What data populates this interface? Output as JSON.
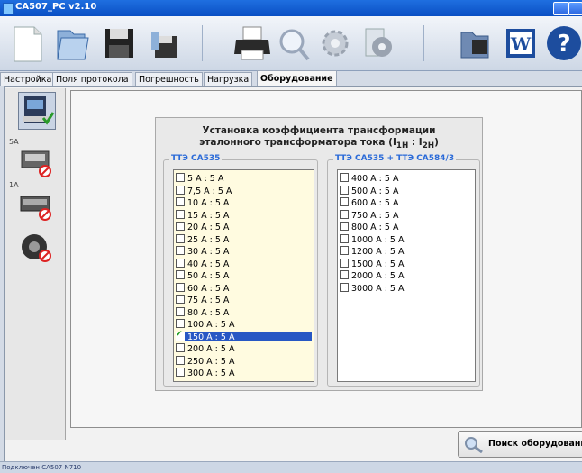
{
  "window": {
    "title": "CA507_PC v2.10"
  },
  "tabs": [
    {
      "label": "Настройка"
    },
    {
      "label": "Поля протокола"
    },
    {
      "label": "Погрешность"
    },
    {
      "label": "Нагрузка"
    },
    {
      "label": "Оборудование",
      "active": true
    }
  ],
  "sidebar": {
    "items": [
      {
        "label": ""
      },
      {
        "label": "5A"
      },
      {
        "label": "1A"
      },
      {
        "label": ""
      }
    ]
  },
  "dialog": {
    "title_line1": "Установка коэффициента трансформации",
    "title_line2": "эталонного трансформатора тока (I",
    "sub_1h": "1Н",
    "colon": " : I",
    "sub_2h": "2Н",
    "close_paren": ")",
    "group_left": {
      "label": "ТТЭ СА535",
      "items": [
        "5 A : 5 A",
        "7,5 A : 5 A",
        "10 A : 5 A",
        "15 A : 5 A",
        "20 A : 5 A",
        "25 A : 5 A",
        "30 A : 5 A",
        "40 A : 5 A",
        "50 A : 5 A",
        "60 A : 5 A",
        "75 A : 5 A",
        "80 A : 5 A",
        "100 A : 5 A",
        "150 A : 5 A",
        "200 A : 5 A",
        "250 A : 5 A",
        "300 A : 5 A"
      ],
      "selected_index": 13
    },
    "group_right": {
      "label": "ТТЭ СА535 + ТТЭ СА584/3",
      "items": [
        "400 A : 5 A",
        "500 A : 5 A",
        "600 A : 5 A",
        "750 A : 5 A",
        "800 A : 5 A",
        "1000 A : 5 A",
        "1200 A : 5 A",
        "1500 A : 5 A",
        "2000 A : 5 A",
        "3000 A : 5 A"
      ]
    }
  },
  "search_button": {
    "label": "Поиск оборудования"
  },
  "status": {
    "text": "Подключен CA507 N710"
  },
  "colors": {
    "accent": "#2a6ad8",
    "selection": "#2757c4",
    "list_left_bg": "#fffbe0",
    "list_right_bg": "#ffffff",
    "titlebar": "#0a4fc4"
  }
}
